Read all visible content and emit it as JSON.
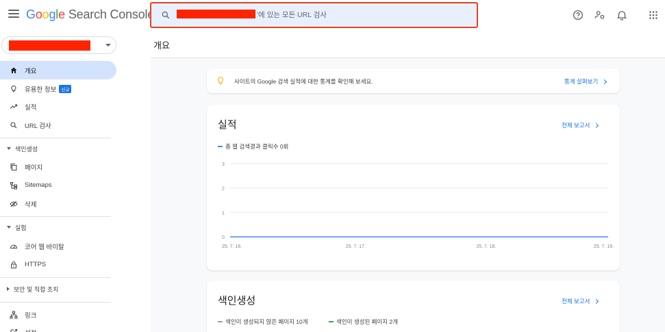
{
  "app": {
    "logo_letters": [
      "G",
      "o",
      "o",
      "g",
      "l",
      "e"
    ],
    "product_name": "Search Console"
  },
  "search": {
    "suffix_text": "'에 있는 모든 URL 검사"
  },
  "sidebar": {
    "items": [
      {
        "label": "개요",
        "icon": "home-icon",
        "active": true
      },
      {
        "label": "유용한 정보",
        "icon": "lightbulb-icon",
        "badge": "신규"
      },
      {
        "label": "실적",
        "icon": "trending-up-icon"
      },
      {
        "label": "URL 검사",
        "icon": "search-icon"
      }
    ],
    "section_indexing": {
      "title": "색인생성",
      "items": [
        {
          "label": "페이지",
          "icon": "pages-icon"
        },
        {
          "label": "Sitemaps",
          "icon": "sitemap-icon"
        },
        {
          "label": "삭제",
          "icon": "removal-icon"
        }
      ]
    },
    "section_experience": {
      "title": "실험",
      "items": [
        {
          "label": "코어 웹 바이탈",
          "icon": "gauge-icon"
        },
        {
          "label": "HTTPS",
          "icon": "lock-icon"
        }
      ]
    },
    "section_security": {
      "title": "보안 및 직접 조치"
    },
    "bottom_items": [
      {
        "label": "링크",
        "icon": "links-icon"
      },
      {
        "label": "설정",
        "icon": "settings-icon"
      }
    ]
  },
  "main": {
    "page_title": "개요",
    "insight_card": {
      "text": "사이트의 Google 검색 실적에 대한 통계를 확인해 보세요.",
      "link": "통계 살펴보기"
    },
    "performance_card": {
      "title": "실적",
      "link": "전체 보고서",
      "legend": "총 웹 검색결과 클릭수 0회"
    },
    "indexing_card": {
      "title": "색인생성",
      "link": "전체 보고서",
      "legend_not_indexed": "색인이 생성되지 않은 페이지 10개",
      "legend_indexed": "색인이 생성된 페이지 2개"
    }
  },
  "colors": {
    "accent": "#1a73e8",
    "active_nav": "#d3e3fd",
    "chart_line": "#4285f4",
    "indexed": "#34a853",
    "not_indexed": "#9aa0a6",
    "redaction": "#ff2400"
  },
  "chart_data": {
    "type": "line",
    "x": [
      "25. 7. 16.",
      "25. 7. 17.",
      "25. 7. 18.",
      "25. 7. 19."
    ],
    "series": [
      {
        "name": "총 웹 검색결과 클릭수 0회",
        "values": [
          0,
          0,
          0,
          0
        ]
      }
    ],
    "yticks": [
      0,
      1,
      2,
      3
    ],
    "ylim": [
      0,
      3
    ],
    "grid": true,
    "legend_position": "top-left"
  }
}
